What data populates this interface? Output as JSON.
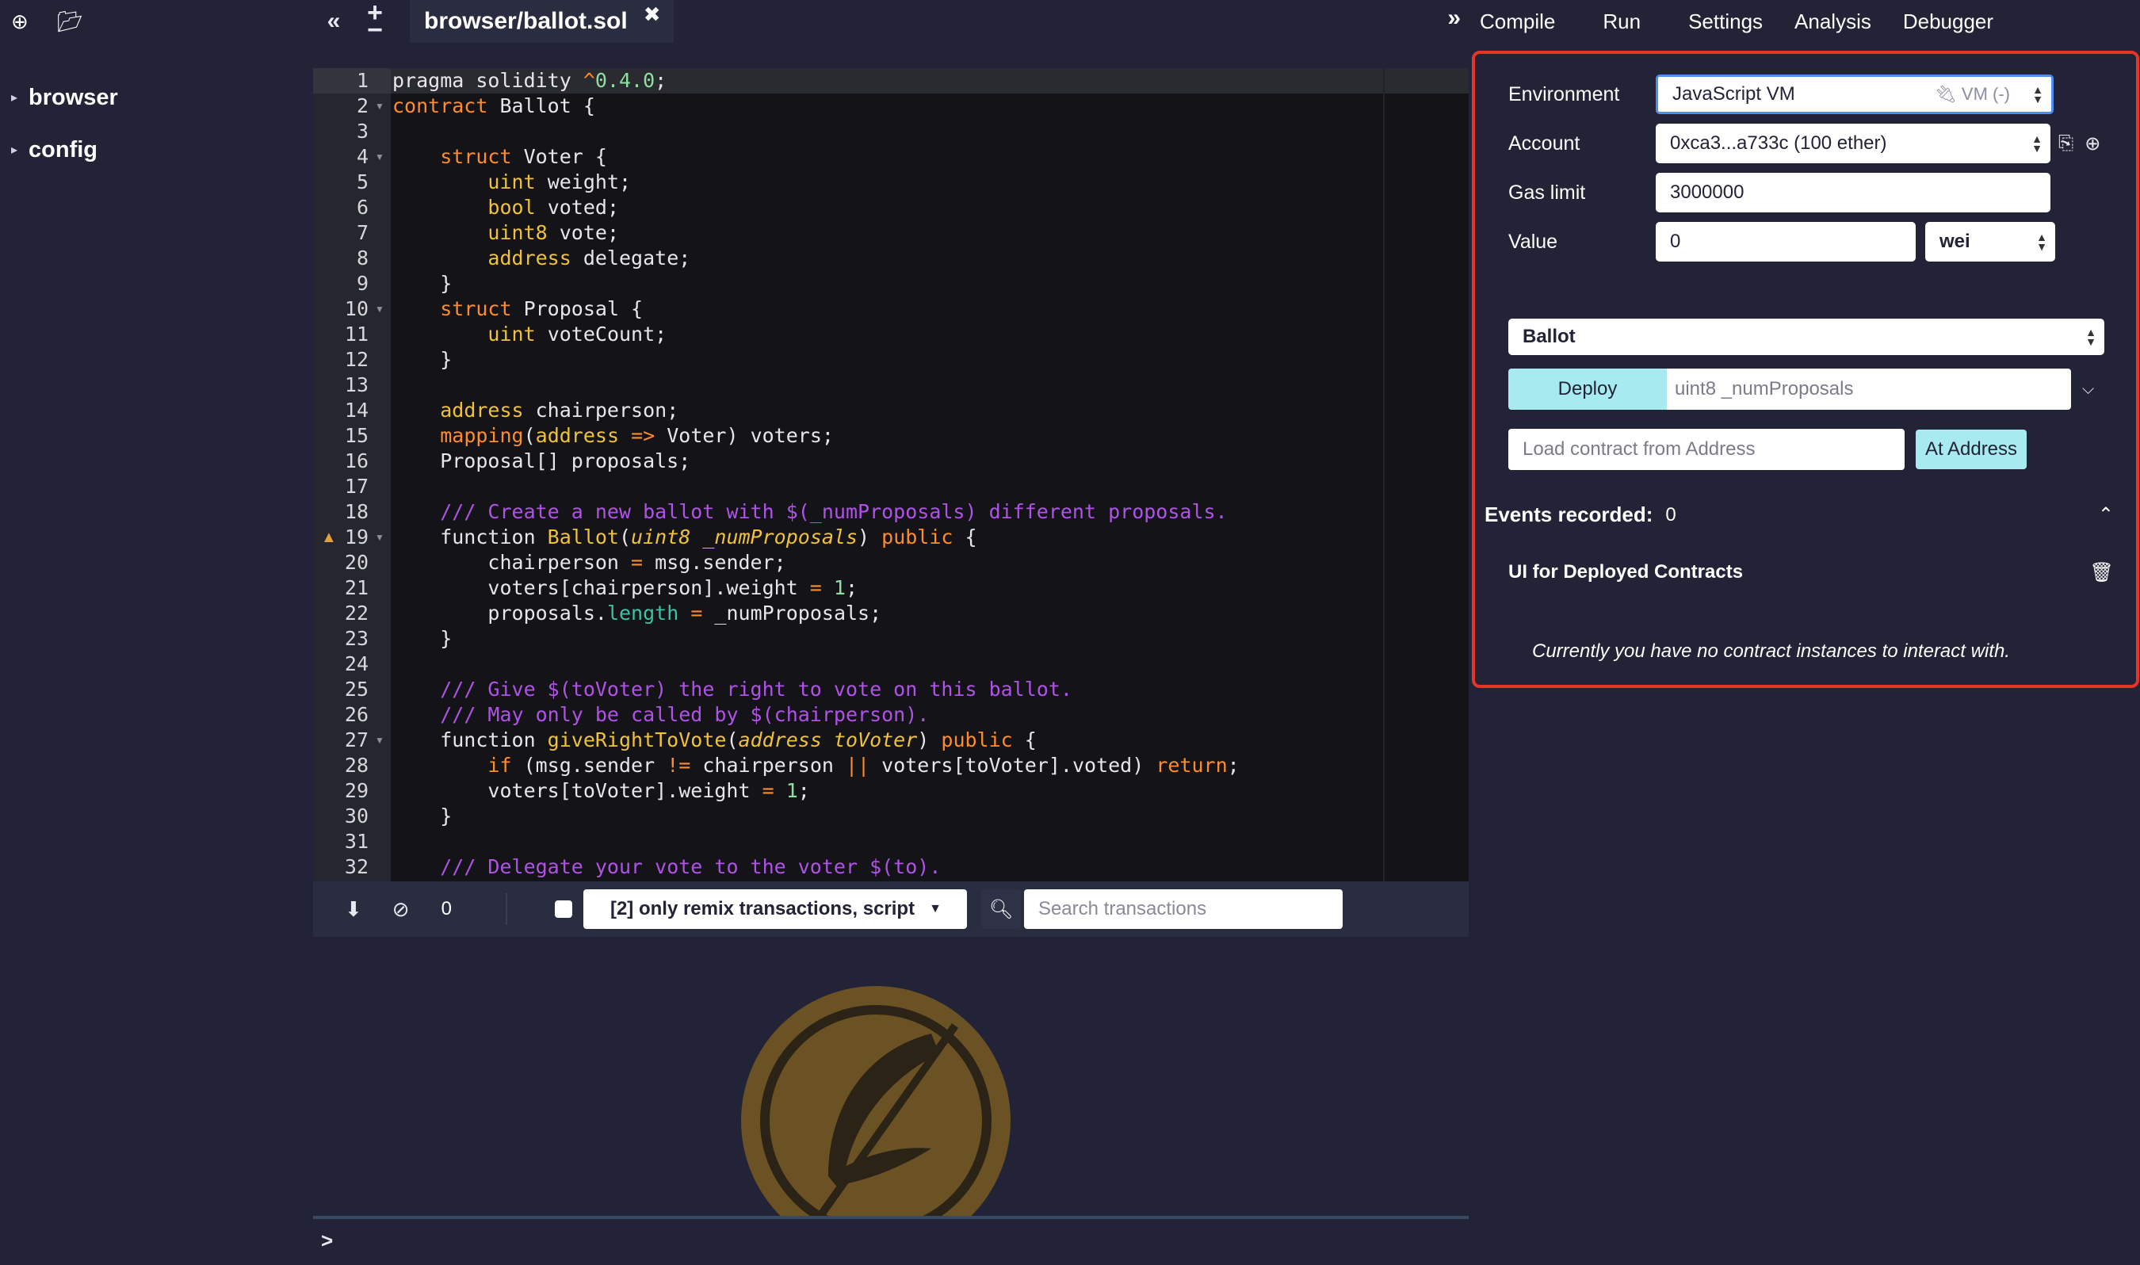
{
  "file_panel": {
    "items": [
      {
        "label": "browser"
      },
      {
        "label": "config"
      }
    ]
  },
  "editor": {
    "tab_title": "browser/ballot.sol"
  },
  "terminal": {
    "tx_count": "0",
    "filter_label": "[2] only remix transactions, script",
    "search_placeholder": "Search transactions",
    "prompt": ">"
  },
  "run_panel": {
    "tabs": [
      "Compile",
      "Run",
      "Settings",
      "Analysis",
      "Debugger"
    ],
    "environment_label": "Environment",
    "environment_value": "JavaScript VM",
    "environment_vm": "VM (-)",
    "account_label": "Account",
    "account_value": "0xca3...a733c (100 ether)",
    "gas_label": "Gas limit",
    "gas_value": "3000000",
    "value_label": "Value",
    "value_value": "0",
    "value_unit": "wei",
    "contract_value": "Ballot",
    "deploy_label": "Deploy",
    "deploy_param": "uint8 _numProposals",
    "load_placeholder": "Load contract from Address",
    "at_address_label": "At Address",
    "events_label": "Events recorded:",
    "events_count": "0",
    "deployed_title": "UI for Deployed Contracts",
    "no_instances": "Currently you have no contract instances to interact with."
  },
  "colors": {
    "accent_border": "#e4352a",
    "deploy_bg": "#a7ebf0",
    "background": "#222336"
  }
}
